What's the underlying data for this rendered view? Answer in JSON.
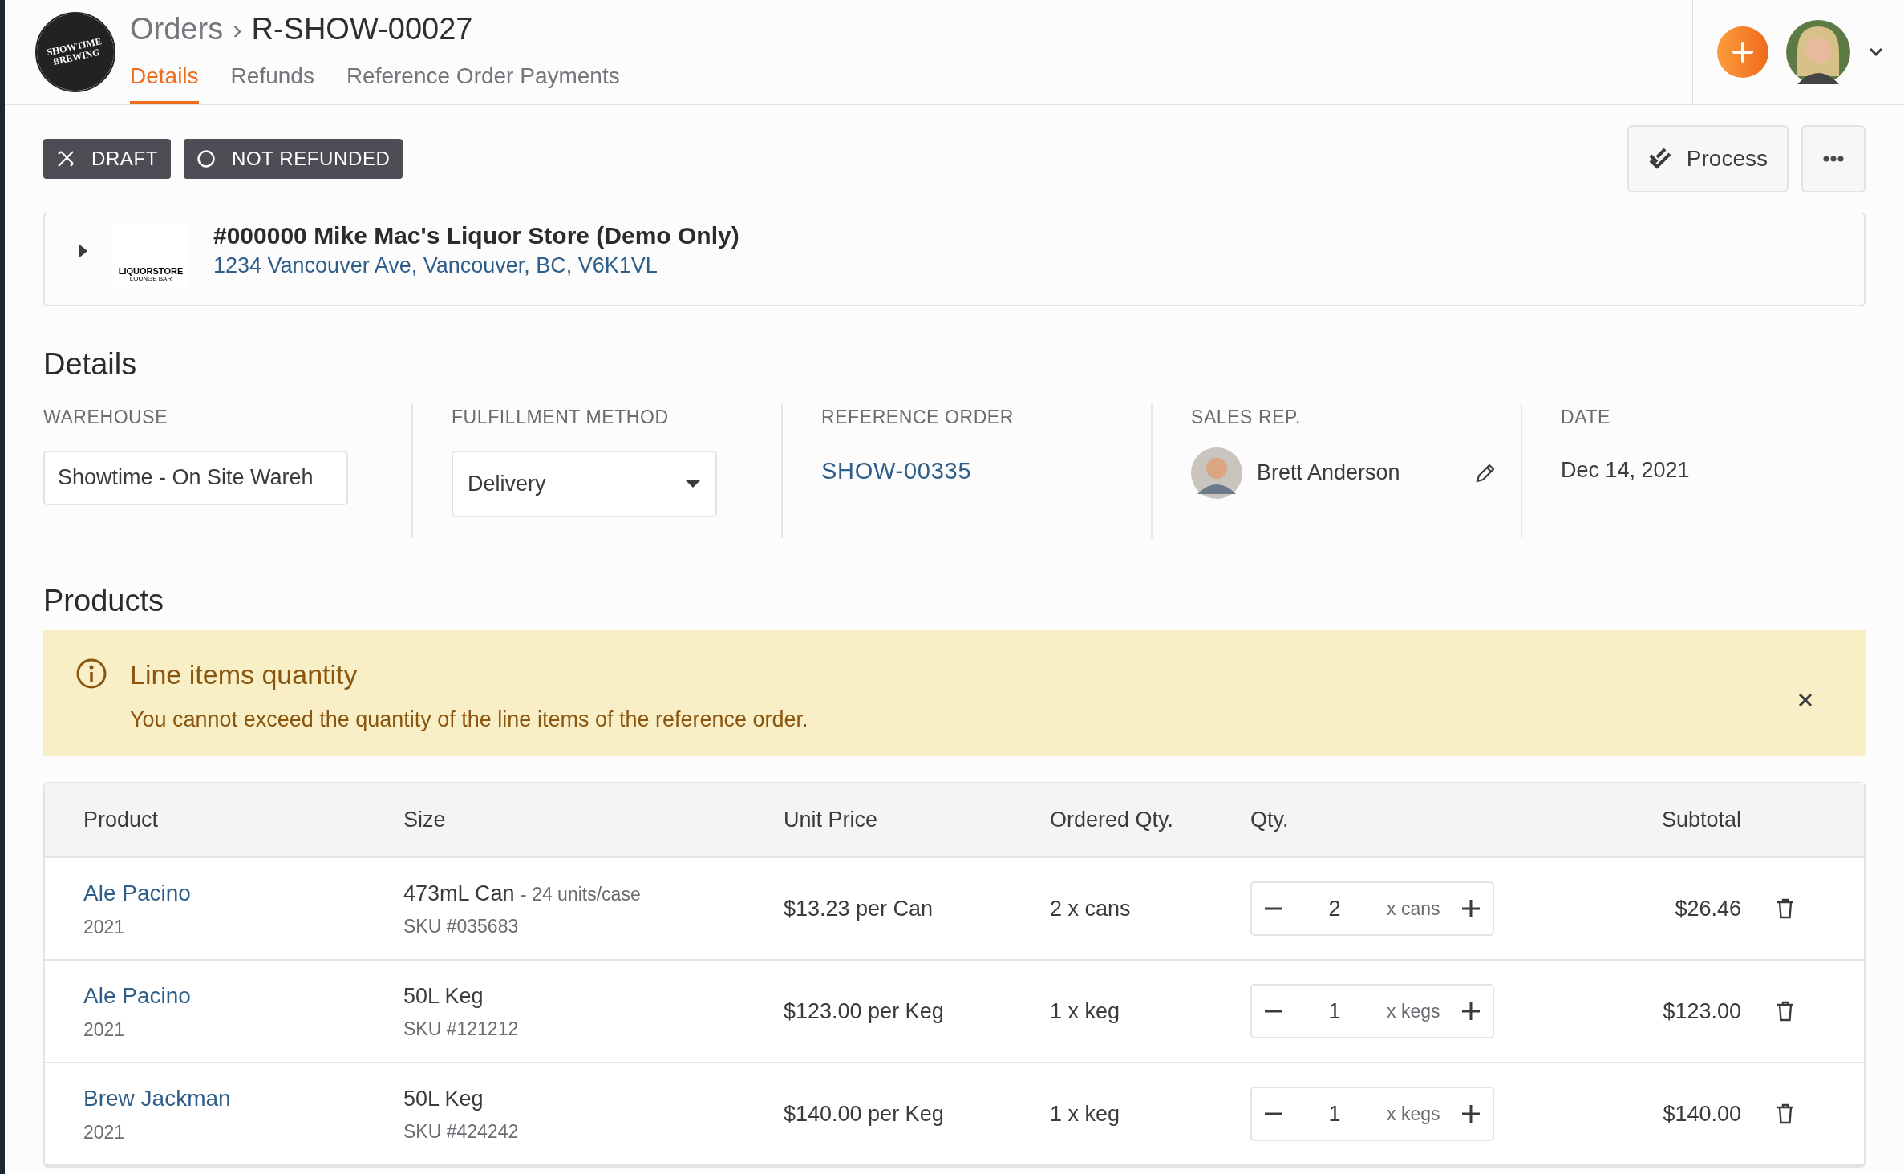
{
  "header": {
    "logo_text": "SHOWTIME BREWING",
    "breadcrumb": "Orders",
    "separator": "›",
    "title": "R-SHOW-00027",
    "tabs": [
      {
        "label": "Details",
        "selected": true
      },
      {
        "label": "Refunds",
        "selected": false
      },
      {
        "label": "Reference Order Payments",
        "selected": false
      }
    ]
  },
  "toolbar": {
    "badges": [
      {
        "kind": "draft",
        "label": "DRAFT"
      },
      {
        "kind": "not_refunded",
        "label": "NOT REFUNDED"
      }
    ],
    "process_label": "Process"
  },
  "customer": {
    "name": "#000000 Mike Mac's Liquor Store (Demo Only)",
    "address": "1234 Vancouver Ave, Vancouver, BC, V6K1VL",
    "logo_text": "LIQUORSTORE",
    "logo_subtext": "LOUNGE BAR",
    "expanded": false
  },
  "details": {
    "title": "Details",
    "fields": [
      {
        "kind": "input",
        "label": "WAREHOUSE",
        "value": "Showtime - On Site Wareh"
      },
      {
        "kind": "select",
        "label": "FULFILLMENT METHOD",
        "value": "Delivery"
      },
      {
        "kind": "link",
        "label": "REFERENCE ORDER",
        "value": "SHOW-00335"
      },
      {
        "kind": "person",
        "label": "SALES REP.",
        "value": "Brett Anderson"
      },
      {
        "kind": "text",
        "label": "DATE",
        "value": "Dec 14, 2021"
      }
    ]
  },
  "products": {
    "title": "Products",
    "alert": {
      "title": "Line items quantity",
      "message": "You cannot exceed the quantity of the line items of the reference order."
    },
    "columns": [
      "Product",
      "Size",
      "Unit Price",
      "Ordered Qty.",
      "Qty.",
      "Subtotal"
    ],
    "rows": [
      {
        "product": "Ale Pacino",
        "year": "2021",
        "size": "473mL Can",
        "size_note": "- 24 units/case",
        "sku": "SKU #035683",
        "unit_price": "$13.23 per Can",
        "ordered_qty": "2 x cans",
        "qty": "2",
        "unit": "x cans",
        "subtotal": "$26.46"
      },
      {
        "product": "Ale Pacino",
        "year": "2021",
        "size": "50L Keg",
        "sku": "SKU #121212",
        "unit_price": "$123.00 per Keg",
        "ordered_qty": "1 x keg",
        "qty": "1",
        "unit": "x kegs",
        "subtotal": "$123.00"
      },
      {
        "product": "Brew Jackman",
        "year": "2021",
        "size": "50L Keg",
        "sku": "SKU #424242",
        "unit_price": "$140.00 per Keg",
        "ordered_qty": "1 x keg",
        "qty": "1",
        "unit": "x kegs",
        "subtotal": "$140.00"
      }
    ]
  }
}
